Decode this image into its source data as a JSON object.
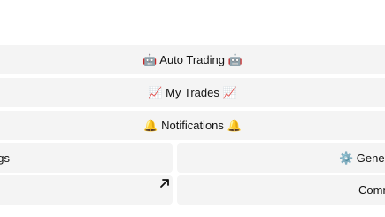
{
  "menu": {
    "auto_trading": {
      "left_icon": "robot-icon",
      "label": "Auto Trading",
      "right_icon": "robot-icon",
      "text": "🤖 Auto Trading 🤖"
    },
    "my_trades": {
      "left_icon": "chart-increasing-icon",
      "label": "My Trades",
      "right_icon": "chart-increasing-icon",
      "text": "📈 My Trades 📈"
    },
    "notifications": {
      "left_icon": "bell-icon",
      "label": "Notifications",
      "right_icon": "bell-icon",
      "text": "🔔 Notifications 🔔"
    },
    "settings_partial": {
      "text": "ngs"
    },
    "general_partial": {
      "icon": "gear-icon",
      "text": "⚙️ Gener"
    },
    "link_button": {
      "icon": "external-arrow-icon"
    },
    "community_partial": {
      "text": "Comm"
    }
  }
}
